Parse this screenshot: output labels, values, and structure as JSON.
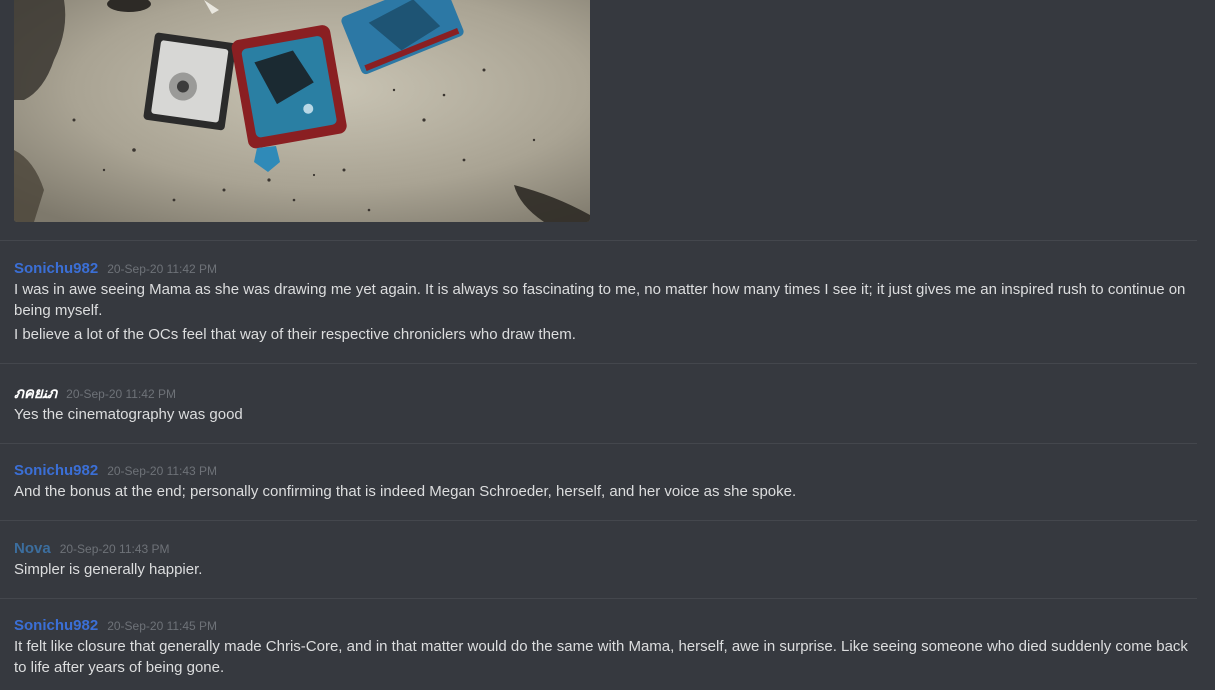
{
  "messages": [
    {
      "author": "Sonichu982",
      "time": "20-Sep-20 11:42 PM",
      "lines": [
        "I was in awe seeing Mama as she was drawing me yet again.  It is always so fascinating to me, no matter how many times I see it; it just gives me an inspired rush to continue on being myself.",
        "I believe a lot of the OCs feel that way of their respective chroniclers who draw them."
      ]
    },
    {
      "author": "ภคยﻨภ",
      "time": "20-Sep-20 11:42 PM",
      "lines": [
        "Yes the cinematography was good"
      ]
    },
    {
      "author": "Sonichu982",
      "time": "20-Sep-20 11:43 PM",
      "lines": [
        "And the bonus at the end; personally confirming that is indeed Megan Schroeder, herself, and her voice as she spoke."
      ]
    },
    {
      "author": "Nova",
      "time": "20-Sep-20 11:43 PM",
      "lines": [
        "Simpler is generally happier."
      ]
    },
    {
      "author": "Sonichu982",
      "time": "20-Sep-20 11:45 PM",
      "lines": [
        "It felt like closure that generally made Chris-Core, and in that matter would do the same with Mama, herself, awe in surprise.  Like seeing someone who died suddenly come back to life after years of being gone."
      ]
    }
  ],
  "colors": {
    "background": "#36393f",
    "author_blue": "#3b6fd6",
    "author_nova": "#3c6e9e",
    "text": "#dcddde",
    "timestamp": "#6e7278"
  }
}
